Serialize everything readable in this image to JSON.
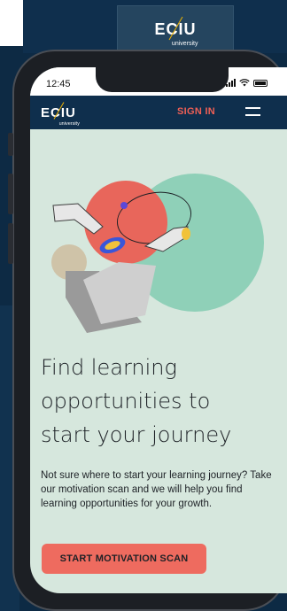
{
  "background_logo": {
    "text": "ECIU",
    "sub": "university"
  },
  "status_bar": {
    "time": "12:45"
  },
  "nav": {
    "logo_text": "ECIU",
    "logo_sub": "university",
    "sign_in_label": "SIGN IN",
    "menu_icon": "hamburger-menu-icon"
  },
  "hero": {
    "headline_lines": [
      "Find learning",
      "opportunities to",
      "start your journey"
    ],
    "body": "Not sure where to start your learning journey? Take our motivation scan and we will help you find learning opportunities for your growth.",
    "cta_label": "START MOTIVATION SCAN"
  },
  "colors": {
    "navy": "#0f2f4d",
    "accent_coral": "#ee6b5f",
    "mint": "#d6e7dd",
    "teal_circle": "#8fd0b8",
    "logo_yellow": "#f0b400"
  }
}
